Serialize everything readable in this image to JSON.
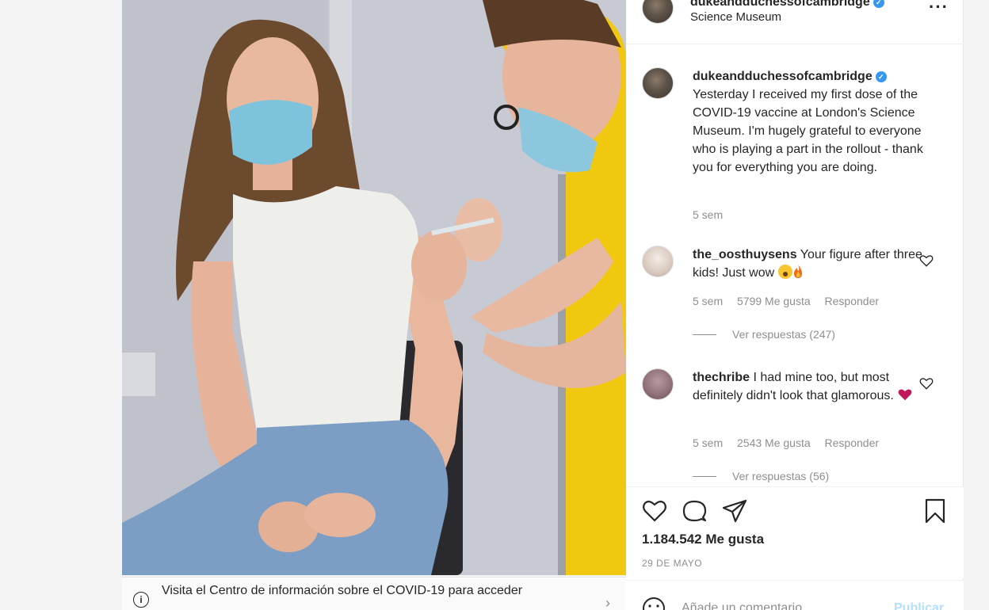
{
  "post": {
    "username": "dukeandduchessofcambridge",
    "location": "Science Museum",
    "more_label": "···"
  },
  "caption": {
    "username": "dukeandduchessofcambridge",
    "text": "Yesterday I received my first dose of the COVID-19 vaccine at London's Science Museum. I'm hugely grateful to everyone who is playing a part in the rollout - thank you for everything you are doing.",
    "time": "5 sem"
  },
  "comments": [
    {
      "username": "the_oosthuysens",
      "text": "Your figure after three kids! Just wow",
      "time": "5 sem",
      "likes": "5799 Me gusta",
      "reply_label": "Responder",
      "view_replies": "Ver respuestas (247)"
    },
    {
      "username": "thechribe",
      "text": "I had mine too, but most definitely didn't look that glamorous.",
      "time": "5 sem",
      "likes": "2543 Me gusta",
      "reply_label": "Responder",
      "view_replies": "Ver respuestas (56)"
    }
  ],
  "actions": {
    "likes": "1.184.542 Me gusta",
    "date": "29 DE MAYO"
  },
  "add_comment": {
    "placeholder": "Añade un comentario...",
    "publish_label": "Publicar"
  },
  "banner": {
    "info_glyph": "i",
    "text": "Visita el Centro de información sobre el COVID-19 para acceder",
    "chevron": "›"
  },
  "colors": {
    "verified": "#3897f0",
    "publish_disabled": "#b2dffc",
    "muted": "#8e8e8e"
  }
}
